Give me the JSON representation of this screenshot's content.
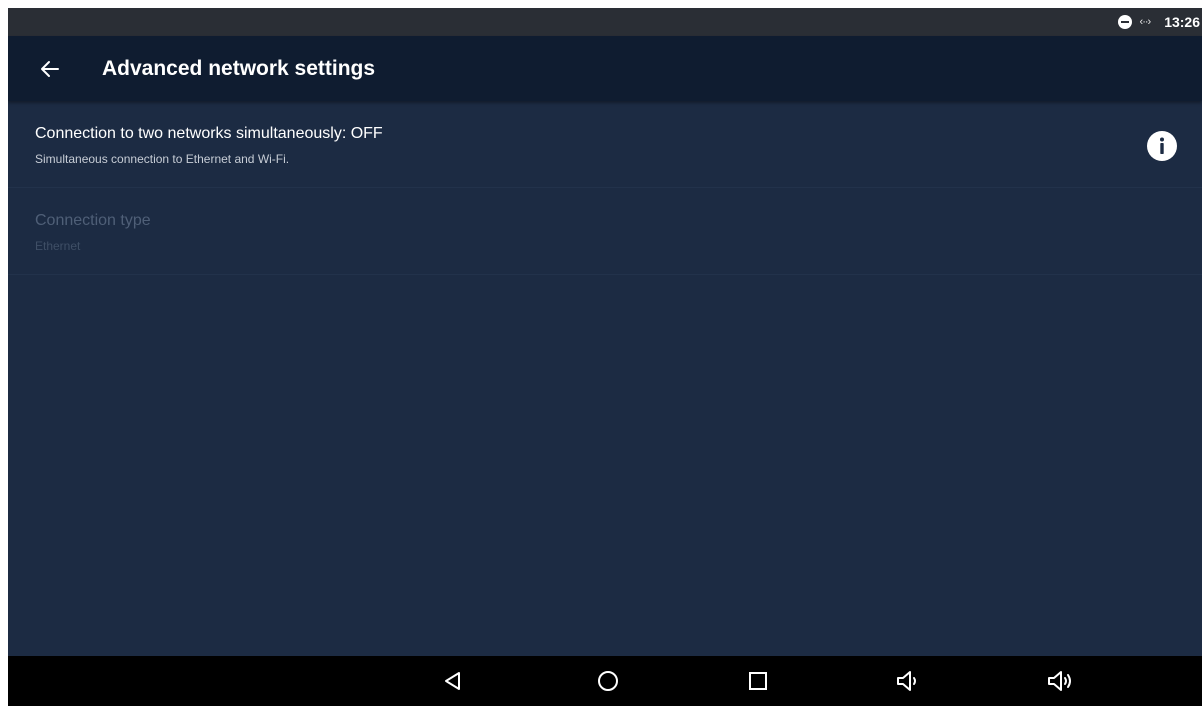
{
  "status_bar": {
    "time": "13:26",
    "icons": [
      "do-not-disturb-icon",
      "ethernet-icon"
    ],
    "ethernet_glyph": "‹··›"
  },
  "app_bar": {
    "title": "Advanced network settings",
    "back_icon": "arrow-left-icon"
  },
  "preferences": [
    {
      "title": "Connection to two networks simultaneously: OFF",
      "summary": "Simultaneous connection to Ethernet and Wi-Fi.",
      "enabled": true,
      "trailing_icon": "info-icon"
    },
    {
      "title": "Connection type",
      "summary": "Ethernet",
      "enabled": false
    }
  ],
  "nav_bar": {
    "buttons": [
      "back-triangle-icon",
      "home-circle-icon",
      "recents-square-icon",
      "volume-down-icon",
      "volume-up-icon"
    ]
  },
  "colors": {
    "background": "#1c2b43",
    "app_bar": "#0f1c30",
    "status_bar": "#2a2e35",
    "nav_bar": "#000000",
    "text_primary": "#ffffff",
    "text_disabled": "#4f5f77"
  }
}
